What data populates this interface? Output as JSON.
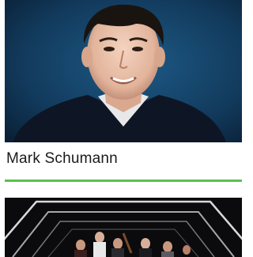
{
  "cards": [
    {
      "image_subject": "portrait-photo",
      "name": "Mark Schumann"
    },
    {
      "image_subject": "ensemble-photo"
    }
  ],
  "colors": {
    "accent": "#5cbf4f",
    "portrait_background": "#123a5c",
    "text": "#1a1a1a"
  }
}
